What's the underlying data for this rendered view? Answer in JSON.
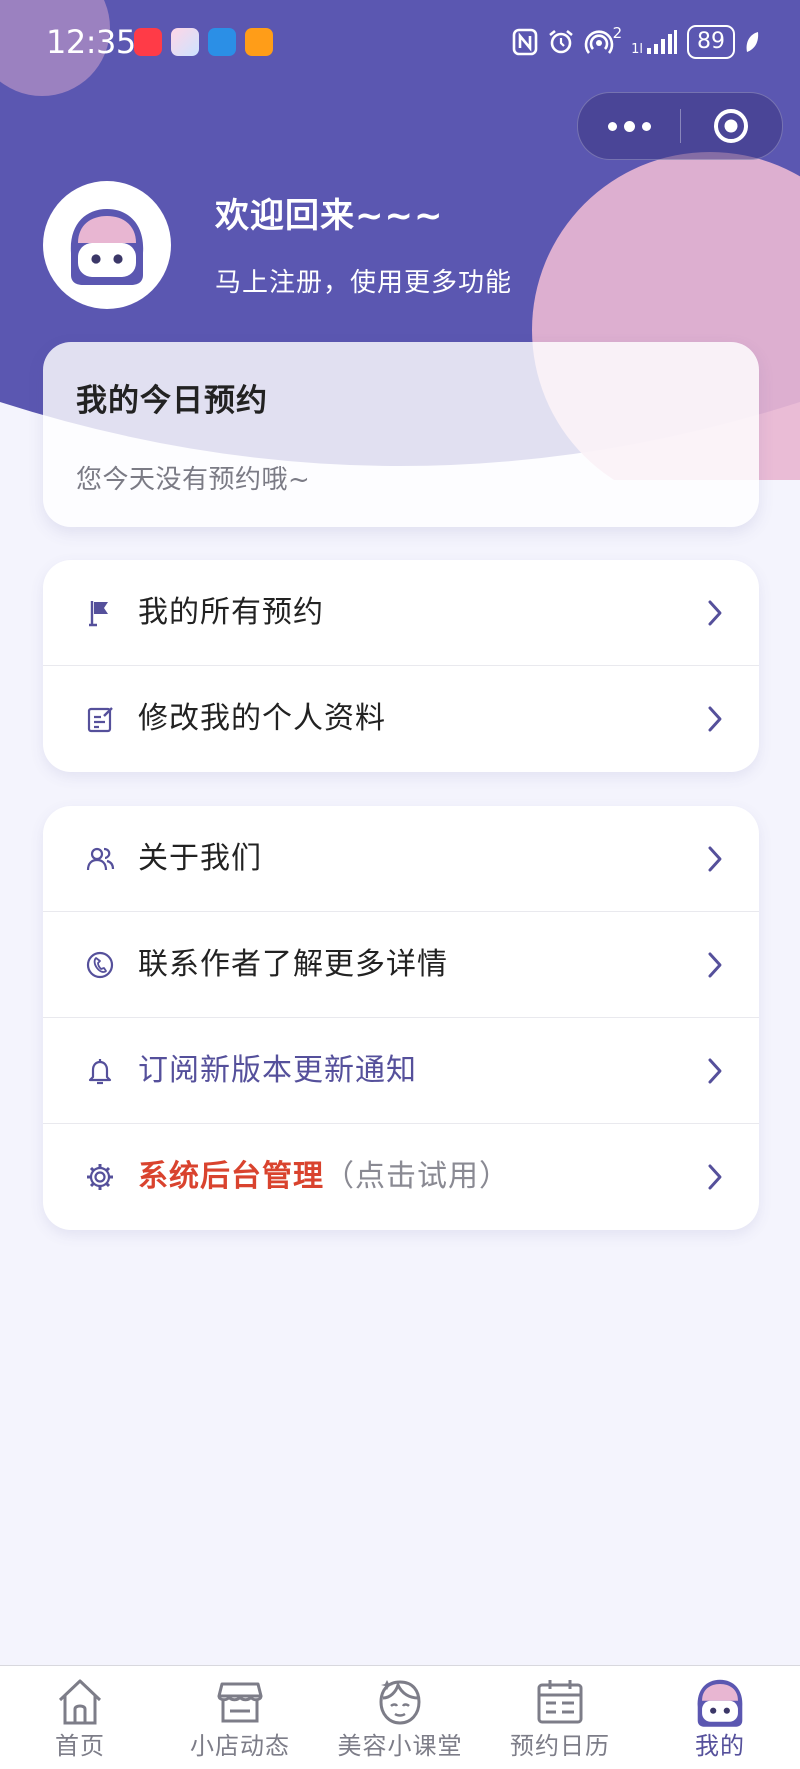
{
  "status_bar": {
    "time": "12:35",
    "network_superscript": "2",
    "signal_prefix": "1l",
    "battery": "89"
  },
  "profile": {
    "welcome": "欢迎回来~~~",
    "subtitle": "马上注册，使用更多功能"
  },
  "today": {
    "title": "我的今日预约",
    "empty_text": "您今天没有预约哦~"
  },
  "menu_group1": [
    {
      "label": "我的所有预约",
      "icon": "flag-icon"
    },
    {
      "label": "修改我的个人资料",
      "icon": "edit-icon"
    }
  ],
  "menu_group2": [
    {
      "label": "关于我们",
      "icon": "users-icon"
    },
    {
      "label": "联系作者了解更多详情",
      "icon": "phone-icon"
    },
    {
      "label": "订阅新版本更新通知",
      "icon": "bell-icon"
    },
    {
      "label": "系统后台管理",
      "hint": "（点击试用）",
      "icon": "gear-icon"
    }
  ],
  "tabs": [
    {
      "label": "首页",
      "icon": "home-icon"
    },
    {
      "label": "小店动态",
      "icon": "shop-icon"
    },
    {
      "label": "美容小课堂",
      "icon": "beauty-face-icon"
    },
    {
      "label": "预约日历",
      "icon": "calendar-icon"
    },
    {
      "label": "我的",
      "icon": "avatar-icon",
      "active": true
    }
  ],
  "colors": {
    "header": "#5b57b1",
    "accent": "#55509b",
    "pink": "#e8b6d2",
    "admin_red": "#d9432e",
    "page_bg": "#f4f4fd"
  }
}
